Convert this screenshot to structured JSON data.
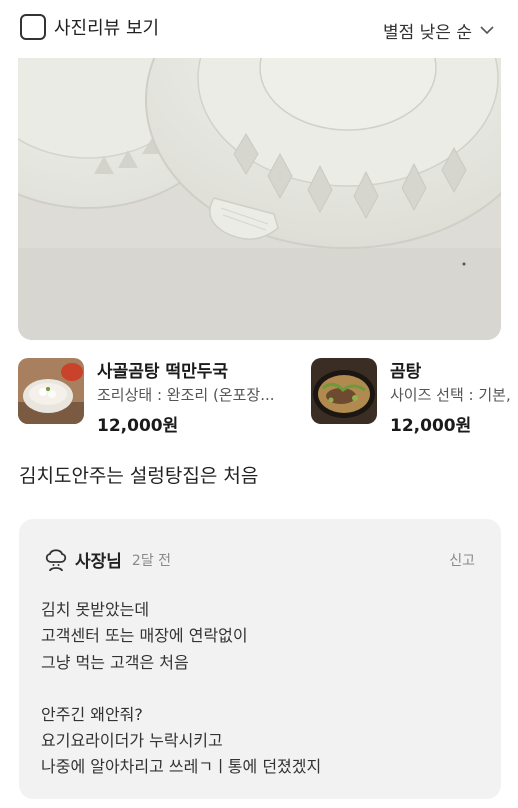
{
  "filter": {
    "photo_review_label": "사진리뷰 보기",
    "sort_label": "별점 낮은 순"
  },
  "products": [
    {
      "name": "사골곰탕 떡만두국",
      "option": "조리상태 : 완조리 (온포장...",
      "price": "12,000원"
    },
    {
      "name": "곰탕",
      "option": "사이즈 선택 : 기본,",
      "price": "12,000원"
    }
  ],
  "review": {
    "text": "김치도안주는 설렁탕집은 처음"
  },
  "owner_reply": {
    "author": "사장님",
    "time": "2달 전",
    "report_label": "신고",
    "lines": [
      "김치 못받았는데",
      "고객센터 또는 매장에 연락없이",
      "그냥 먹는 고객은 처음",
      "",
      "안주긴 왜안줘?",
      "요기요라이더가 누락시키고",
      "나중에 알아차리고 쓰레ㄱㅣ통에 던졌겠지"
    ]
  },
  "colors": {
    "reply_background": "#f2f2f2",
    "meta_text": "#8a8a8a"
  },
  "icons": [
    "checkbox-icon",
    "chevron-down-icon",
    "chef-icon"
  ]
}
